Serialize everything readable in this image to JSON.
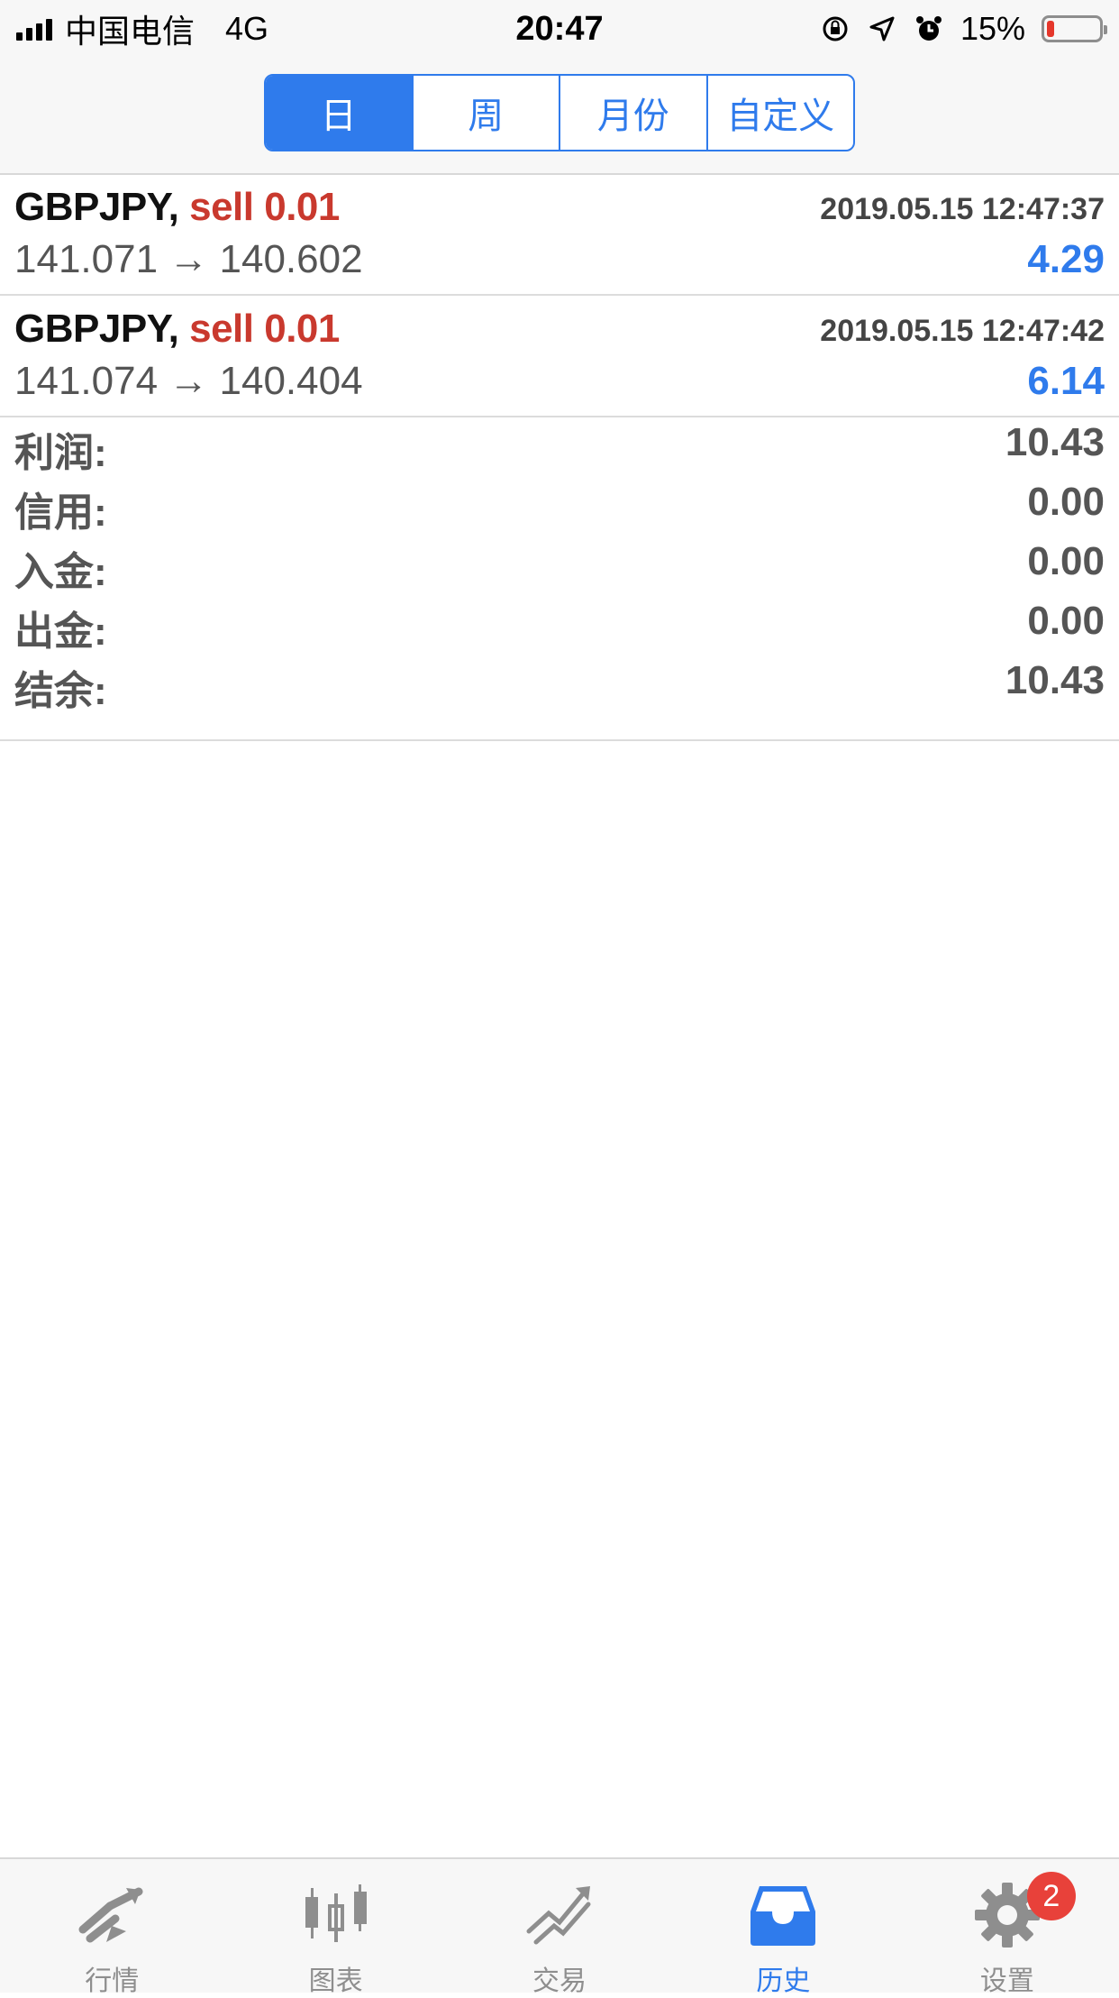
{
  "status_bar": {
    "carrier": "中国电信",
    "network": "4G",
    "time": "20:47",
    "battery_percent": "15%",
    "battery_level": 0.15,
    "icons": [
      "orientation-lock-icon",
      "location-icon",
      "alarm-icon",
      "battery-icon"
    ]
  },
  "period_tabs": [
    {
      "label": "日",
      "active": true
    },
    {
      "label": "周",
      "active": false
    },
    {
      "label": "月份",
      "active": false
    },
    {
      "label": "自定义",
      "active": false
    }
  ],
  "deals": [
    {
      "symbol": "GBPJPY,",
      "side": "sell 0.01",
      "time": "2019.05.15 12:47:37",
      "prices": "141.071 → 140.602",
      "profit": "4.29"
    },
    {
      "symbol": "GBPJPY,",
      "side": "sell 0.01",
      "time": "2019.05.15 12:47:42",
      "prices": "141.074 → 140.404",
      "profit": "6.14"
    }
  ],
  "summary": [
    {
      "label": "利润:",
      "value": "10.43"
    },
    {
      "label": "信用:",
      "value": "0.00"
    },
    {
      "label": "入金:",
      "value": "0.00"
    },
    {
      "label": "出金:",
      "value": "0.00"
    },
    {
      "label": "结余:",
      "value": "10.43"
    }
  ],
  "tab_bar": [
    {
      "label": "行情",
      "icon": "quotes-icon",
      "active": false
    },
    {
      "label": "图表",
      "icon": "chart-icon",
      "active": false
    },
    {
      "label": "交易",
      "icon": "trade-icon",
      "active": false
    },
    {
      "label": "历史",
      "icon": "history-icon",
      "active": true
    },
    {
      "label": "设置",
      "icon": "settings-icon",
      "active": false,
      "badge": "2"
    }
  ],
  "colors": {
    "accent": "#2f7bec",
    "sell": "#c9392e",
    "inactive_icon": "#8e8e8e",
    "badge": "#e8413a"
  }
}
